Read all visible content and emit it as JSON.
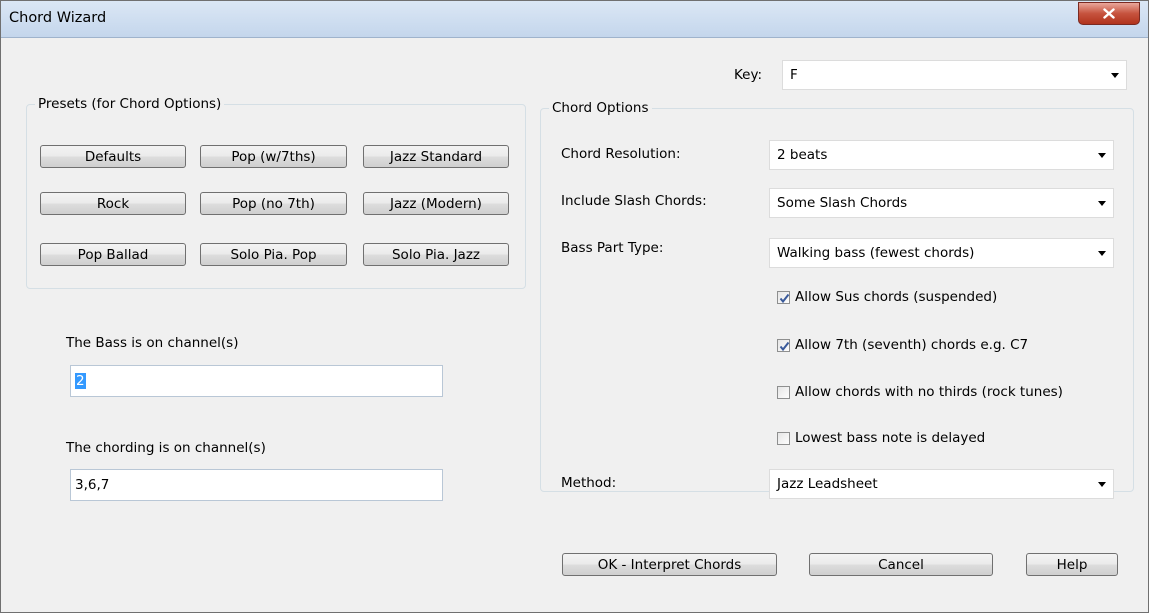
{
  "window": {
    "title": "Chord Wizard"
  },
  "key": {
    "label": "Key:",
    "value": "F"
  },
  "presets": {
    "title": "Presets  (for Chord Options)",
    "buttons": [
      "Defaults",
      "Pop (w/7ths)",
      "Jazz Standard",
      "Rock",
      "Pop (no 7th)",
      "Jazz (Modern)",
      "Pop Ballad",
      "Solo Pia. Pop",
      "Solo Pia. Jazz"
    ]
  },
  "bass": {
    "label": "The Bass is on channel(s)",
    "value": "2"
  },
  "chording": {
    "label": "The chording is on channel(s)",
    "value": "3,6,7"
  },
  "chord_options": {
    "title": "Chord Options",
    "resolution": {
      "label": "Chord Resolution:",
      "value": "2 beats"
    },
    "slash": {
      "label": "Include Slash Chords:",
      "value": "Some Slash Chords"
    },
    "bass_type": {
      "label": "Bass Part Type:",
      "value": "Walking bass (fewest chords)"
    },
    "checkboxes": [
      {
        "label": "Allow Sus chords (suspended)",
        "checked": true
      },
      {
        "label": "Allow 7th (seventh) chords e.g. C7",
        "checked": true
      },
      {
        "label": "Allow chords with no thirds (rock tunes)",
        "checked": false
      },
      {
        "label": "Lowest bass note is delayed",
        "checked": false
      }
    ],
    "method": {
      "label": "Method:",
      "value": "Jazz Leadsheet"
    }
  },
  "actions": {
    "ok": "OK - Interpret Chords",
    "cancel": "Cancel",
    "help": "Help"
  },
  "icons": {
    "close": "close-icon",
    "dropdown": "chevron-down-icon",
    "checkmark": "checkmark-icon"
  },
  "colors": {
    "selection": "#3399ff",
    "close_button": "#c6533e",
    "titlebar": "#c4d6ec",
    "checkmark": "#3a5a9a"
  }
}
